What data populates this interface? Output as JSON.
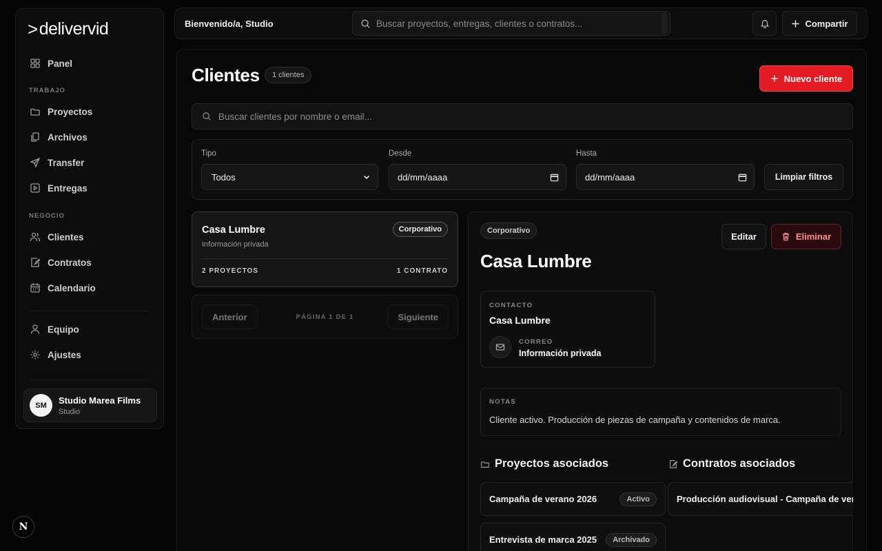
{
  "brand": {
    "prefix": ">",
    "name": "delivervid"
  },
  "sidebar": {
    "panel": "Panel",
    "section_work": "TRABAJO",
    "work_items": [
      "Proyectos",
      "Archivos",
      "Transfer",
      "Entregas"
    ],
    "section_business": "NEGOCIO",
    "business_items": [
      "Clientes",
      "Contratos",
      "Calendario"
    ],
    "team": "Equipo",
    "settings": "Ajustes",
    "account": {
      "initials": "SM",
      "name": "Studio Marea Films",
      "role": "Studio"
    }
  },
  "topbar": {
    "welcome": "Bienvenido/a, Studio",
    "search_placeholder": "Buscar proyectos, entregas, clientes o contratos...",
    "share_label": "Compartir"
  },
  "page": {
    "title": "Clientes",
    "count": "1 clientes",
    "new_client": "Nuevo cliente",
    "search_placeholder": "Buscar clientes por nombre o email..."
  },
  "filters": {
    "type_label": "Tipo",
    "type_value": "Todos",
    "from_label": "Desde",
    "from_value": "dd/mm/aaaa",
    "to_label": "Hasta",
    "to_value": "dd/mm/aaaa",
    "clear": "Limpiar filtros"
  },
  "client_list": [
    {
      "name": "Casa Lumbre",
      "subtitle": "Información privada",
      "type": "Corporativo",
      "projects": "2 PROYECTOS",
      "contracts": "1 CONTRATO"
    }
  ],
  "pagination": {
    "prev": "Anterior",
    "info": "PÁGINA 1 DE 1",
    "next": "Siguiente"
  },
  "detail": {
    "type": "Corporativo",
    "name": "Casa Lumbre",
    "edit": "Editar",
    "delete": "Eliminar",
    "contact_label": "CONTACTO",
    "contact_name": "Casa Lumbre",
    "email_label": "CORREO",
    "email_value": "Información privada",
    "notes_label": "NOTAS",
    "notes": "Cliente activo. Producción de piezas de campaña y contenidos de marca.",
    "projects_title": "Proyectos asociados",
    "contracts_title": "Contratos asociados",
    "projects": [
      {
        "name": "Campaña de verano 2026",
        "status": "Activo"
      },
      {
        "name": "Entrevista de marca 2025",
        "status": "Archivado"
      }
    ],
    "contracts": [
      {
        "name": "Producción audiovisual - Campaña de verano"
      }
    ]
  },
  "colors": {
    "accent": "#e31b23",
    "danger_text": "#ff8f94",
    "background": "#050505"
  },
  "icons": [
    "grid-icon",
    "folder-icon",
    "files-icon",
    "send-icon",
    "play-icon",
    "users-icon",
    "contract-icon",
    "calendar-icon",
    "user-icon",
    "gear-icon",
    "search-icon",
    "bell-icon",
    "plus-icon",
    "trash-icon",
    "mail-icon"
  ]
}
